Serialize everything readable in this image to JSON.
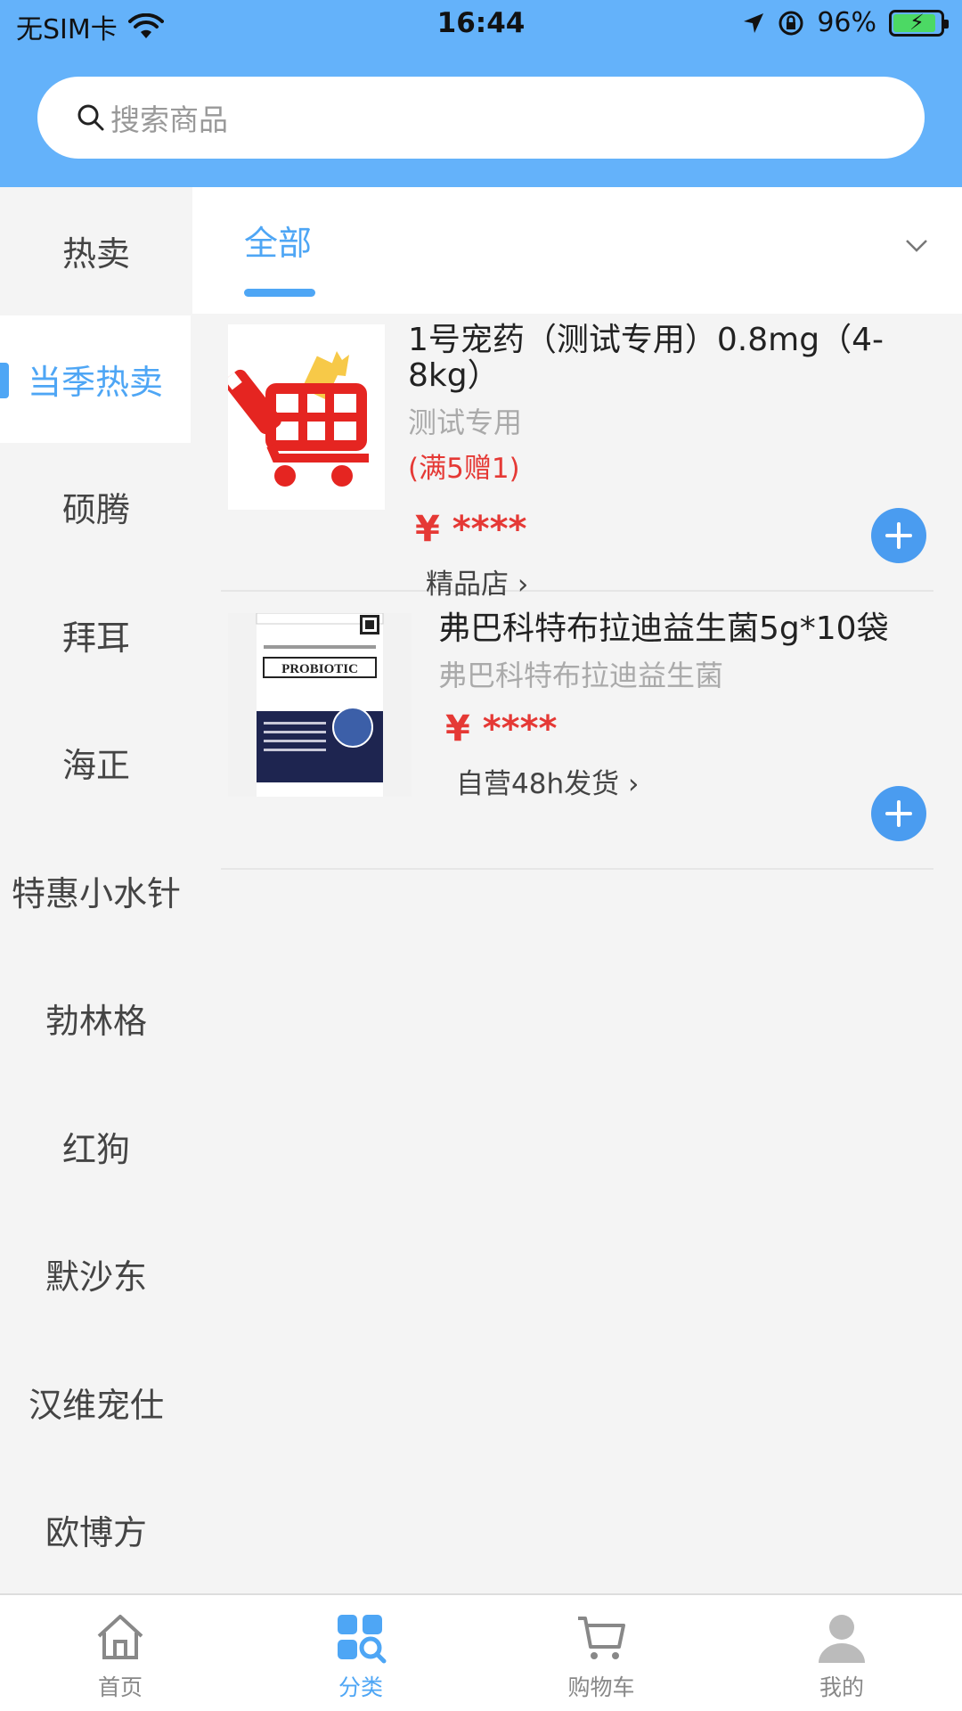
{
  "status": {
    "carrier": "无SIM卡",
    "time": "16:44",
    "battery": "96%"
  },
  "search": {
    "placeholder": "搜索商品"
  },
  "sidebar": {
    "items": [
      {
        "label": "热卖"
      },
      {
        "label": "当季热卖",
        "active": true
      },
      {
        "label": "硕腾"
      },
      {
        "label": "拜耳"
      },
      {
        "label": "海正"
      },
      {
        "label": "特惠小水针"
      },
      {
        "label": "勃林格"
      },
      {
        "label": "红狗"
      },
      {
        "label": "默沙东"
      },
      {
        "label": "汉维宠仕"
      },
      {
        "label": "欧博方"
      }
    ]
  },
  "tabs": {
    "active": "全部"
  },
  "products": [
    {
      "title": "1号宠药（测试专用）0.8mg（4-8kg）",
      "subtitle": "测试专用",
      "promo": "(满5赠1)",
      "price": "¥ ****",
      "shop": "精品店 ›"
    },
    {
      "title": "弗巴科特布拉迪益生菌5g*10袋",
      "subtitle": "弗巴科特布拉迪益生菌",
      "price": "¥ ****",
      "shop": "自营48h发货 ›",
      "image_text": "PROBIOTIC"
    }
  ],
  "nav": {
    "items": [
      {
        "label": "首页",
        "icon": "home-icon"
      },
      {
        "label": "分类",
        "icon": "category-icon",
        "active": true
      },
      {
        "label": "购物车",
        "icon": "cart-icon"
      },
      {
        "label": "我的",
        "icon": "profile-icon"
      }
    ]
  },
  "colors": {
    "header": "#64b2fa",
    "accent": "#4ea6f5",
    "price": "#e53935"
  }
}
